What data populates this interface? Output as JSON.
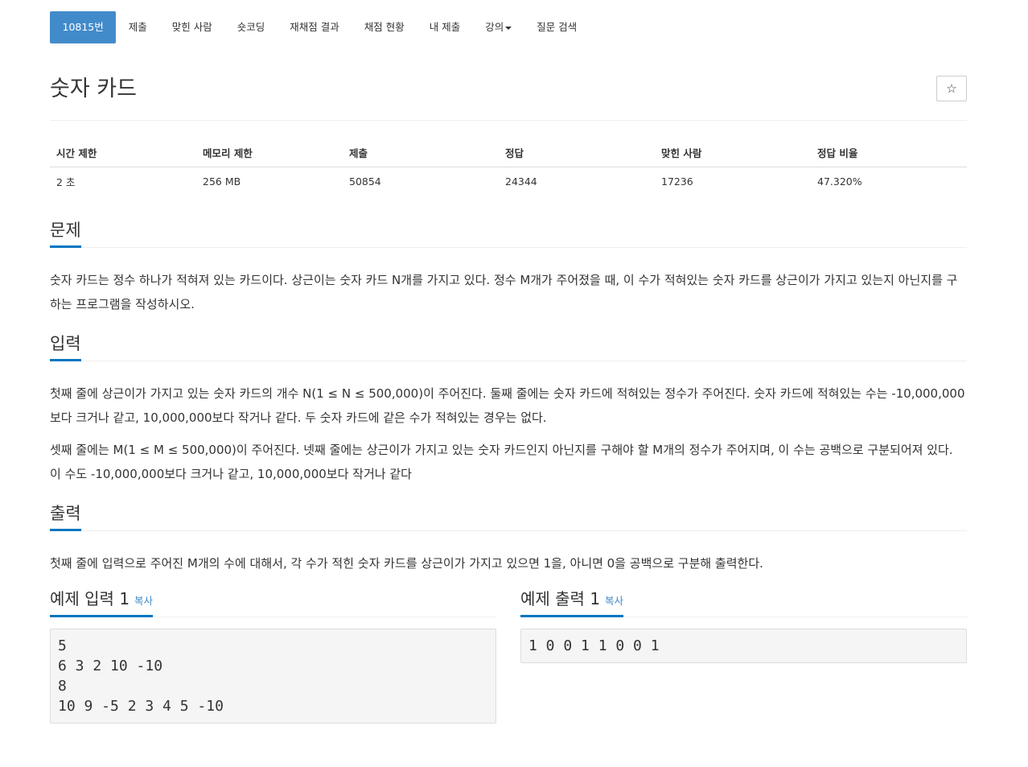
{
  "nav": {
    "problem_number": "10815번",
    "submit": "제출",
    "solved_users": "맞힌 사람",
    "shortest_code": "숏코딩",
    "rejudge_result": "재채점 결과",
    "judge_status": "채점 현황",
    "my_submissions": "내 제출",
    "lectures": "강의",
    "question_search": "질문 검색"
  },
  "problem": {
    "title": "숫자 카드",
    "star_icon": "☆"
  },
  "info_table": {
    "headers": [
      "시간 제한",
      "메모리 제한",
      "제출",
      "정답",
      "맞힌 사람",
      "정답 비율"
    ],
    "values": [
      "2 초",
      "256 MB",
      "50854",
      "24344",
      "17236",
      "47.320%"
    ]
  },
  "sections": {
    "description": {
      "heading": "문제",
      "text": "숫자 카드는 정수 하나가 적혀져 있는 카드이다. 상근이는 숫자 카드 N개를 가지고 있다. 정수 M개가 주어졌을 때, 이 수가 적혀있는 숫자 카드를 상근이가 가지고 있는지 아닌지를 구하는 프로그램을 작성하시오."
    },
    "input": {
      "heading": "입력",
      "text1": "첫째 줄에 상근이가 가지고 있는 숫자 카드의 개수 N(1 ≤ N ≤ 500,000)이 주어진다. 둘째 줄에는 숫자 카드에 적혀있는 정수가 주어진다. 숫자 카드에 적혀있는 수는 -10,000,000보다 크거나 같고, 10,000,000보다 작거나 같다. 두 숫자 카드에 같은 수가 적혀있는 경우는 없다.",
      "text2": "셋째 줄에는 M(1 ≤ M ≤ 500,000)이 주어진다. 넷째 줄에는 상근이가 가지고 있는 숫자 카드인지 아닌지를 구해야 할 M개의 정수가 주어지며, 이 수는 공백으로 구분되어져 있다. 이 수도 -10,000,000보다 크거나 같고, 10,000,000보다 작거나 같다"
    },
    "output": {
      "heading": "출력",
      "text": "첫째 줄에 입력으로 주어진 M개의 수에 대해서, 각 수가 적힌 숫자 카드를 상근이가 가지고 있으면 1을, 아니면 0을 공백으로 구분해 출력한다."
    }
  },
  "samples": {
    "input": {
      "heading": "예제 입력 1",
      "copy": "복사",
      "content": "5\n6 3 2 10 -10\n8\n10 9 -5 2 3 4 5 -10"
    },
    "output": {
      "heading": "예제 출력 1",
      "copy": "복사",
      "content": "1 0 0 1 1 0 0 1"
    }
  },
  "colors": {
    "accent": "#428bca",
    "underline": "#0076c0"
  }
}
